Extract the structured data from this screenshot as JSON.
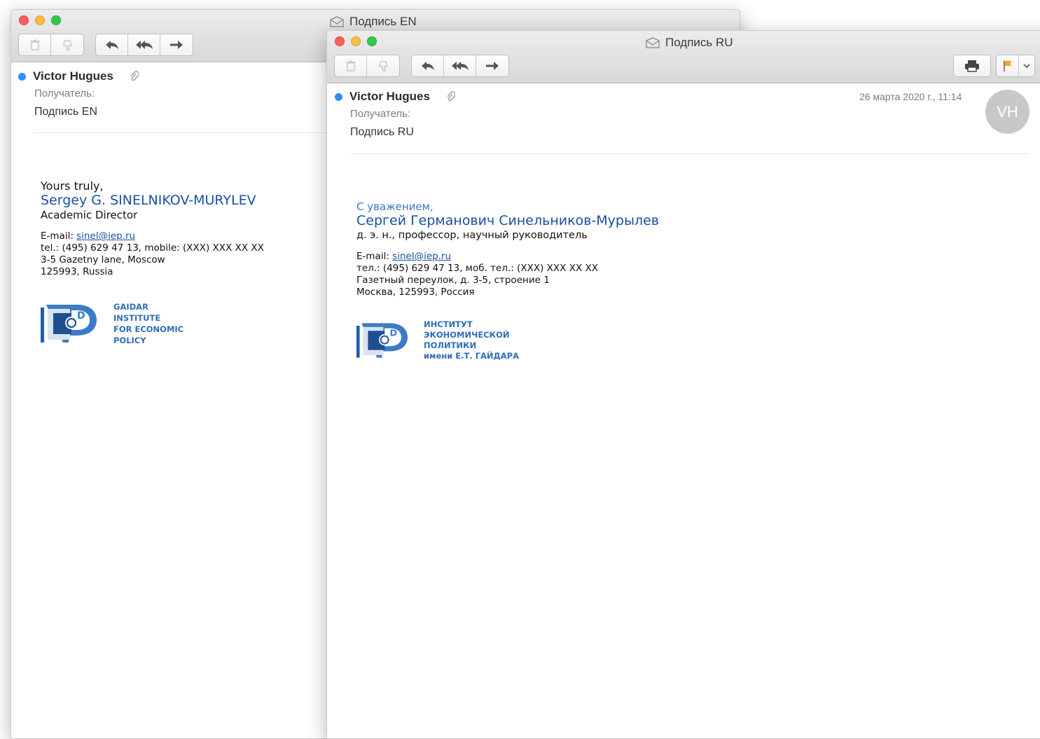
{
  "colors": {
    "accent": "#2f8ff5",
    "signature_blue": "#1a4fa0",
    "flag": "#f6a623"
  },
  "window_en": {
    "title": "Подпись EN",
    "sender": "Victor Hugues",
    "recipient_label": "Получатель:",
    "subject": "Подпись EN",
    "signature": {
      "greeting": "Yours truly,",
      "name": "Sergey G. SINELNIKOV-MURYLEV",
      "position": "Academic Director",
      "email_label": "E-mail: ",
      "email": "sinel@iep.ru",
      "phone": "tel.: (495) 629 47 13, mobile: (XXX) XXX XX XX",
      "address1": "3-5 Gazetny lane, Moscow",
      "address2": "125993, Russia",
      "logo_lines": [
        "GAIDAR",
        "INSTITUTE",
        "FOR ECONOMIC",
        "POLICY"
      ]
    }
  },
  "window_ru": {
    "title": "Подпись RU",
    "sender": "Victor Hugues",
    "date": "26 марта 2020 г., 11:14",
    "avatar_initials": "VH",
    "recipient_label": "Получатель:",
    "subject": "Подпись RU",
    "signature": {
      "greeting": "С уважением,",
      "name": "Сергей Германович Синельников-Мурылев",
      "position": "д. э. н., профессор, научный руководитель",
      "email_label": "E-mail: ",
      "email": "sinel@iep.ru",
      "phone": "тел.: (495) 629 47 13, моб. тел.: (XXX) XXX XX XX",
      "address1": "Газетный переулок, д. 3-5, строение 1",
      "address2": "Москва, 125993, Россия",
      "logo_lines": [
        "ИНСТИТУТ",
        "ЭКОНОМИЧЕСКОЙ",
        "ПОЛИТИКИ",
        "имени Е.Т. ГАЙДАРА"
      ]
    }
  },
  "icons": {
    "toolbar_left": [
      "trash-icon",
      "junk-icon"
    ],
    "toolbar_reply": [
      "reply-icon",
      "reply-all-icon",
      "forward-icon"
    ],
    "toolbar_right": [
      "print-icon",
      "flag-icon",
      "chevron-down-icon"
    ],
    "other": [
      "envelope-icon",
      "paperclip-icon",
      "iep-logo-icon"
    ]
  }
}
